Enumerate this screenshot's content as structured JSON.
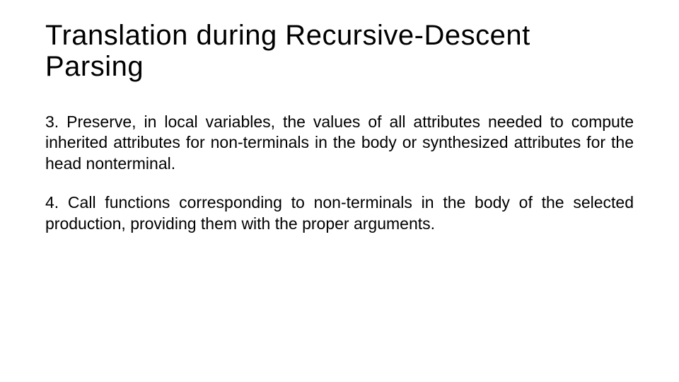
{
  "title": "Translation during Recursive-Descent Parsing",
  "items": [
    "3. Preserve, in local variables, the values of all attributes needed to compute inherited attributes for non-terminals in the body or synthesized attributes for the head nonterminal.",
    "4. Call functions corresponding to non-terminals in the body of the selected production, providing them with the proper arguments."
  ]
}
